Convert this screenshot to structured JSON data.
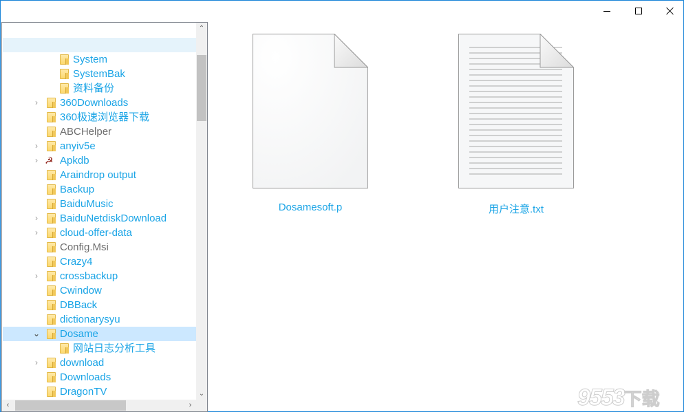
{
  "window": {
    "controls": {
      "minimize": "minimize",
      "maximize": "maximize",
      "close": "close"
    }
  },
  "tree": {
    "items": [
      {
        "label": "",
        "level": 2,
        "expander": "none",
        "icon": "none",
        "state": "hover",
        "muted": false
      },
      {
        "label": "System",
        "level": 2,
        "expander": "none",
        "icon": "folder-icon",
        "state": "",
        "muted": false
      },
      {
        "label": "SystemBak",
        "level": 2,
        "expander": "none",
        "icon": "folder-icon",
        "state": "",
        "muted": false
      },
      {
        "label": "资料备份",
        "level": 2,
        "expander": "none",
        "icon": "folder-icon",
        "state": "",
        "muted": false
      },
      {
        "label": "360Downloads",
        "level": 1,
        "expander": "collapsed",
        "icon": "folder-icon",
        "state": "",
        "muted": false
      },
      {
        "label": "360极速浏览器下载",
        "level": 1,
        "expander": "none",
        "icon": "folder-icon",
        "state": "",
        "muted": false
      },
      {
        "label": "ABCHelper",
        "level": 1,
        "expander": "none",
        "icon": "folder-icon",
        "state": "",
        "muted": true
      },
      {
        "label": "anyiv5e",
        "level": 1,
        "expander": "collapsed",
        "icon": "folder-icon",
        "state": "",
        "muted": false
      },
      {
        "label": "Apkdb",
        "level": 1,
        "expander": "collapsed",
        "icon": "hammer-sickle-icon",
        "state": "",
        "muted": false
      },
      {
        "label": "Araindrop output",
        "level": 1,
        "expander": "none",
        "icon": "folder-icon",
        "state": "",
        "muted": false
      },
      {
        "label": "Backup",
        "level": 1,
        "expander": "none",
        "icon": "folder-icon",
        "state": "",
        "muted": false
      },
      {
        "label": "BaiduMusic",
        "level": 1,
        "expander": "none",
        "icon": "folder-icon",
        "state": "",
        "muted": false
      },
      {
        "label": "BaiduNetdiskDownload",
        "level": 1,
        "expander": "collapsed",
        "icon": "folder-icon",
        "state": "",
        "muted": false
      },
      {
        "label": "cloud-offer-data",
        "level": 1,
        "expander": "collapsed",
        "icon": "folder-icon",
        "state": "",
        "muted": false
      },
      {
        "label": "Config.Msi",
        "level": 1,
        "expander": "none",
        "icon": "folder-icon",
        "state": "",
        "muted": true
      },
      {
        "label": "Crazy4",
        "level": 1,
        "expander": "none",
        "icon": "folder-icon",
        "state": "",
        "muted": false
      },
      {
        "label": "crossbackup",
        "level": 1,
        "expander": "collapsed",
        "icon": "folder-icon",
        "state": "",
        "muted": false
      },
      {
        "label": "Cwindow",
        "level": 1,
        "expander": "none",
        "icon": "folder-icon",
        "state": "",
        "muted": false
      },
      {
        "label": "DBBack",
        "level": 1,
        "expander": "none",
        "icon": "folder-icon",
        "state": "",
        "muted": false
      },
      {
        "label": "dictionarysyu",
        "level": 1,
        "expander": "none",
        "icon": "folder-icon",
        "state": "",
        "muted": false
      },
      {
        "label": "Dosame",
        "level": 1,
        "expander": "expanded",
        "icon": "folder-icon",
        "state": "selected",
        "muted": false
      },
      {
        "label": "网站日志分析工具",
        "level": 2,
        "expander": "none",
        "icon": "folder-icon",
        "state": "",
        "muted": false
      },
      {
        "label": "download",
        "level": 1,
        "expander": "collapsed",
        "icon": "folder-icon",
        "state": "",
        "muted": false
      },
      {
        "label": "Downloads",
        "level": 1,
        "expander": "none",
        "icon": "folder-icon",
        "state": "",
        "muted": false
      },
      {
        "label": "DragonTV",
        "level": 1,
        "expander": "none",
        "icon": "folder-icon",
        "state": "",
        "muted": false
      }
    ],
    "glyphs": {
      "collapsed": "›",
      "expanded": "⌄",
      "hammer": "☭"
    },
    "scrollbar": {
      "vertical_position": 0.12,
      "horizontal_position": 0.0,
      "up": "⌃",
      "down": "⌄",
      "left": "‹",
      "right": "›"
    }
  },
  "files": [
    {
      "name": "Dosamesoft.p",
      "type": "blank-document-icon"
    },
    {
      "name": "用户注意.txt",
      "type": "text-document-icon"
    }
  ],
  "watermark": {
    "number": "9553",
    "suffix": "下载"
  },
  "colors": {
    "accent_text": "#1aa4e6",
    "muted_text": "#6d6d6d",
    "selection": "#cce8ff",
    "hover": "#e5f3fb",
    "window_border": "#1883d7"
  }
}
